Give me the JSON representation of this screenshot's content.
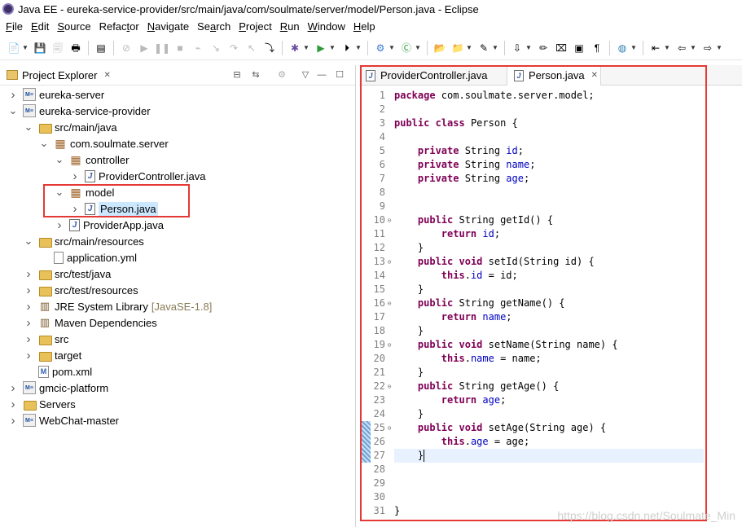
{
  "window": {
    "title": "Java EE - eureka-service-provider/src/main/java/com/soulmate/server/model/Person.java - Eclipse"
  },
  "menu": [
    {
      "mn": "F",
      "rest": "ile"
    },
    {
      "mn": "E",
      "rest": "dit"
    },
    {
      "mn": "S",
      "rest": "ource"
    },
    {
      "pre": "Refac",
      "mn": "t",
      "rest": "or"
    },
    {
      "mn": "N",
      "rest": "avigate"
    },
    {
      "pre": "Se",
      "mn": "a",
      "rest": "rch"
    },
    {
      "mn": "P",
      "rest": "roject"
    },
    {
      "mn": "R",
      "rest": "un"
    },
    {
      "mn": "W",
      "rest": "indow"
    },
    {
      "mn": "H",
      "rest": "elp"
    }
  ],
  "toolbar_icons": [
    "new-icon",
    "save-icon",
    "save-all-icon",
    "print-icon",
    "terminal-icon",
    "skip-breakpoints-icon",
    "resume-icon",
    "suspend-icon",
    "terminate-icon",
    "disconnect-icon",
    "step-into-icon",
    "step-over-icon",
    "step-return-icon",
    "drop-to-frame-icon",
    "debug-icon",
    "run-icon",
    "run-external-icon",
    "new-server-icon",
    "new-java-class-icon",
    "open-type-icon",
    "open-task-icon",
    "search-icon",
    "next-annotation-icon",
    "toggle-mark-occurrences-icon",
    "toggle-block-selection-icon",
    "show-whitespace-icon",
    "pilcrow-icon",
    "globe-icon",
    "last-edit-location-icon",
    "back-icon",
    "forward-icon"
  ],
  "explorer": {
    "title": "Project Explorer",
    "tree": [
      {
        "label": "eureka-server",
        "icon": "project",
        "level": 0,
        "twisty": "collapsed"
      },
      {
        "label": "eureka-service-provider",
        "icon": "project",
        "level": 0,
        "twisty": "expanded"
      },
      {
        "label": "src/main/java",
        "icon": "folder",
        "level": 1,
        "twisty": "expanded"
      },
      {
        "label": "com.soulmate.server",
        "icon": "package",
        "level": 2,
        "twisty": "expanded"
      },
      {
        "label": "controller",
        "icon": "package",
        "level": 3,
        "twisty": "expanded"
      },
      {
        "label": "ProviderController.java",
        "icon": "java",
        "level": 4,
        "twisty": "collapsed"
      },
      {
        "label": "model",
        "icon": "package",
        "level": 3,
        "twisty": "expanded"
      },
      {
        "label": "Person.java",
        "icon": "java",
        "level": 4,
        "twisty": "collapsed",
        "selected": true
      },
      {
        "label": "ProviderApp.java",
        "icon": "java",
        "level": 3,
        "twisty": "collapsed"
      },
      {
        "label": "src/main/resources",
        "icon": "folder",
        "level": 1,
        "twisty": "expanded"
      },
      {
        "label": "application.yml",
        "icon": "file",
        "level": 2,
        "twisty": "none"
      },
      {
        "label": "src/test/java",
        "icon": "folder",
        "level": 1,
        "twisty": "collapsed"
      },
      {
        "label": "src/test/resources",
        "icon": "folder",
        "level": 1,
        "twisty": "collapsed"
      },
      {
        "label": "JRE System Library",
        "decoration": "[JavaSE-1.8]",
        "icon": "library",
        "level": 1,
        "twisty": "collapsed"
      },
      {
        "label": "Maven Dependencies",
        "icon": "library",
        "level": 1,
        "twisty": "collapsed"
      },
      {
        "label": "src",
        "icon": "folder",
        "level": 1,
        "twisty": "collapsed"
      },
      {
        "label": "target",
        "icon": "folder",
        "level": 1,
        "twisty": "collapsed"
      },
      {
        "label": "pom.xml",
        "icon": "xml",
        "level": 1,
        "twisty": "none"
      },
      {
        "label": "gmcic-platform",
        "icon": "project",
        "level": 0,
        "twisty": "collapsed"
      },
      {
        "label": "Servers",
        "icon": "folder",
        "level": 0,
        "twisty": "collapsed"
      },
      {
        "label": "WebChat-master",
        "icon": "project",
        "level": 0,
        "twisty": "collapsed"
      }
    ]
  },
  "editor": {
    "tabs": [
      {
        "label": "ProviderController.java",
        "active": false
      },
      {
        "label": "Person.java",
        "active": true
      }
    ],
    "lines": [
      [
        [
          "kw",
          "package"
        ],
        [
          "t",
          " com.soulmate.server.model;"
        ]
      ],
      [],
      [
        [
          "kw",
          "public"
        ],
        [
          "t",
          " "
        ],
        [
          "kw",
          "class"
        ],
        [
          "t",
          " Person {"
        ]
      ],
      [],
      [
        [
          "t",
          "    "
        ],
        [
          "kw",
          "private"
        ],
        [
          "t",
          " String "
        ],
        [
          "f",
          "id"
        ],
        [
          "t",
          ";"
        ]
      ],
      [
        [
          "t",
          "    "
        ],
        [
          "kw",
          "private"
        ],
        [
          "t",
          " String "
        ],
        [
          "f",
          "name"
        ],
        [
          "t",
          ";"
        ]
      ],
      [
        [
          "t",
          "    "
        ],
        [
          "kw",
          "private"
        ],
        [
          "t",
          " String "
        ],
        [
          "f",
          "age"
        ],
        [
          "t",
          ";"
        ]
      ],
      [],
      [],
      [
        [
          "t",
          "    "
        ],
        [
          "kw",
          "public"
        ],
        [
          "t",
          " String getId() {"
        ]
      ],
      [
        [
          "t",
          "        "
        ],
        [
          "kw",
          "return"
        ],
        [
          "t",
          " "
        ],
        [
          "f",
          "id"
        ],
        [
          "t",
          ";"
        ]
      ],
      [
        [
          "t",
          "    }"
        ]
      ],
      [
        [
          "t",
          "    "
        ],
        [
          "kw",
          "public"
        ],
        [
          "t",
          " "
        ],
        [
          "kw",
          "void"
        ],
        [
          "t",
          " setId(String id) {"
        ]
      ],
      [
        [
          "t",
          "        "
        ],
        [
          "kw",
          "this"
        ],
        [
          "t",
          "."
        ],
        [
          "f",
          "id"
        ],
        [
          "t",
          " = id;"
        ]
      ],
      [
        [
          "t",
          "    }"
        ]
      ],
      [
        [
          "t",
          "    "
        ],
        [
          "kw",
          "public"
        ],
        [
          "t",
          " String getName() {"
        ]
      ],
      [
        [
          "t",
          "        "
        ],
        [
          "kw",
          "return"
        ],
        [
          "t",
          " "
        ],
        [
          "f",
          "name"
        ],
        [
          "t",
          ";"
        ]
      ],
      [
        [
          "t",
          "    }"
        ]
      ],
      [
        [
          "t",
          "    "
        ],
        [
          "kw",
          "public"
        ],
        [
          "t",
          " "
        ],
        [
          "kw",
          "void"
        ],
        [
          "t",
          " setName(String name) {"
        ]
      ],
      [
        [
          "t",
          "        "
        ],
        [
          "kw",
          "this"
        ],
        [
          "t",
          "."
        ],
        [
          "f",
          "name"
        ],
        [
          "t",
          " = name;"
        ]
      ],
      [
        [
          "t",
          "    }"
        ]
      ],
      [
        [
          "t",
          "    "
        ],
        [
          "kw",
          "public"
        ],
        [
          "t",
          " String getAge() {"
        ]
      ],
      [
        [
          "t",
          "        "
        ],
        [
          "kw",
          "return"
        ],
        [
          "t",
          " "
        ],
        [
          "f",
          "age"
        ],
        [
          "t",
          ";"
        ]
      ],
      [
        [
          "t",
          "    }"
        ]
      ],
      [
        [
          "t",
          "    "
        ],
        [
          "kw",
          "public"
        ],
        [
          "t",
          " "
        ],
        [
          "kw",
          "void"
        ],
        [
          "t",
          " setAge(String age) {"
        ]
      ],
      [
        [
          "t",
          "        "
        ],
        [
          "kw",
          "this"
        ],
        [
          "t",
          "."
        ],
        [
          "f",
          "age"
        ],
        [
          "t",
          " = age;"
        ]
      ],
      [
        [
          "t",
          "    }"
        ]
      ],
      [],
      [],
      [],
      [
        [
          "t",
          "}"
        ]
      ]
    ],
    "fold_lines": [
      10,
      13,
      16,
      19,
      22,
      25
    ],
    "current_line": 27
  },
  "watermark": "https://blog.csdn.net/Soulmate_Min"
}
